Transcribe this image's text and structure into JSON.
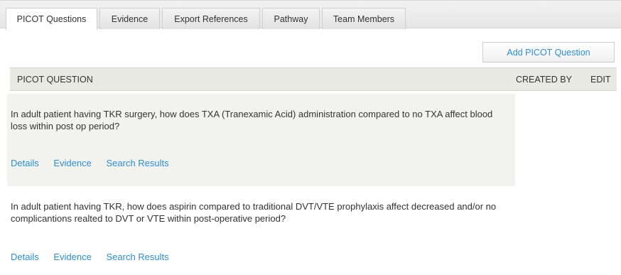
{
  "tabs": [
    {
      "label": "PICOT Questions",
      "active": true
    },
    {
      "label": "Evidence",
      "active": false
    },
    {
      "label": "Export References",
      "active": false
    },
    {
      "label": "Pathway",
      "active": false
    },
    {
      "label": "Team Members",
      "active": false
    }
  ],
  "add_button_label": "Add PICOT Question",
  "table": {
    "headers": {
      "question": "PICOT QUESTION",
      "created_by": "CREATED BY",
      "edit": "EDIT"
    },
    "rows": [
      {
        "question": "In adult patient having TKR surgery, how does TXA (Tranexamic Acid) administration compared to no TXA affect blood loss within post op period?",
        "links": {
          "details": "Details",
          "evidence": "Evidence",
          "search_results": "Search Results"
        }
      },
      {
        "question": "In adult patient having TKR, how does aspirin compared to traditional DVT/VTE prophylaxis affect decreased and/or no complicantions realted to DVT or VTE within post-operative period?",
        "links": {
          "details": "Details",
          "evidence": "Evidence",
          "search_results": "Search Results"
        }
      }
    ]
  },
  "colors": {
    "link": "#2a8fd6",
    "header_bg": "#e9e9e4",
    "shaded_row_bg": "#f2f2ee"
  }
}
